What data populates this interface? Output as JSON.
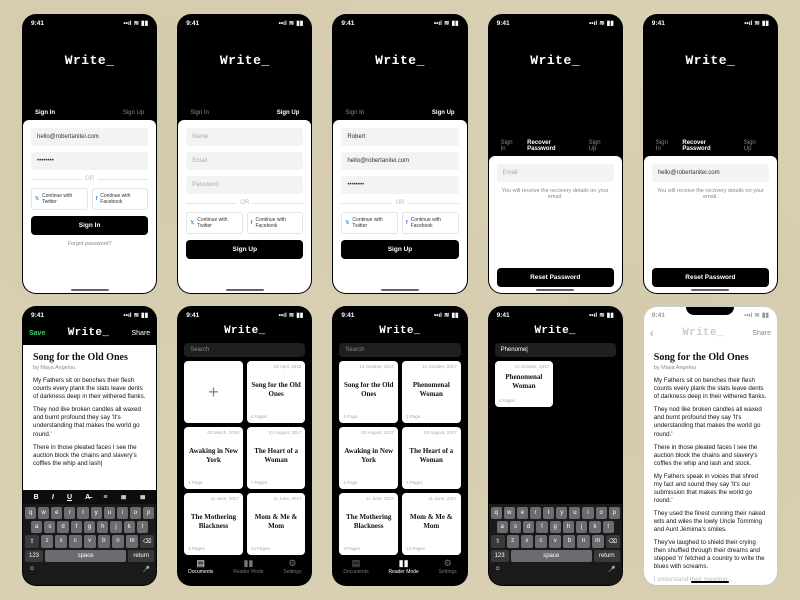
{
  "status": {
    "time": "9:41",
    "signal": "••ıl",
    "wifi": "≋",
    "battery": "▮▮"
  },
  "brand": "Write_",
  "tabs": {
    "signin": "Sign In",
    "signup": "Sign Up",
    "recover": "Recover Password"
  },
  "fields": {
    "email_val": "hello@robertanitei.com",
    "pw_val": "••••••••",
    "name_val": "Robert",
    "name_ph": "Name",
    "email_ph": "Email",
    "password_ph": "Password"
  },
  "or": "OR",
  "social": {
    "twitter": "Continue with Twitter",
    "facebook": "Continue with Facebook"
  },
  "buttons": {
    "signin": "Sign In",
    "signup": "Sign Up",
    "reset": "Reset Password"
  },
  "links": {
    "forgot": "Forgot password?"
  },
  "helper": {
    "recover": "You will receive the recovery details on your email."
  },
  "editor": {
    "save": "Save",
    "share": "Share",
    "back": "‹",
    "title": "Song for the Old Ones",
    "byline": "by Maya Angelou",
    "p1": "My Fathers sit on benches their flesh counts every plank the slats leave dents of darkness deep in their withered flanks.",
    "p2": "They nod like broken candles all waxed and burnt profound they say 'It's understanding that makes the world go round.'",
    "p3": "There in those pleated faces I see the auction block the chains and slavery's coffles the whip and lash|",
    "p3b": "There in those pleated faces I see the auction block the chains and slavery's coffles the whip and lash and stock.",
    "p4": "My Fathers speak in voices that shred my fact and sound they say 'It's our submission that makes the world go round.'",
    "p5": "They used the finest cunning their naked wits and wiles the lowly Uncle Tomming and Aunt Jemima's smiles.",
    "p6": "They've laughed to shield their crying then shuffled through their dreams and stepped 'n' fetched a country to write the blues with screams.",
    "p7": "I understand their meaning..."
  },
  "toolbar": {
    "bold": "B",
    "italic": "I",
    "underline": "U",
    "strike": "A̶",
    "alignl": "≡",
    "alignc": "≣",
    "alignr": "≣"
  },
  "keyboard": {
    "r1": [
      "q",
      "w",
      "e",
      "r",
      "t",
      "y",
      "u",
      "i",
      "o",
      "p"
    ],
    "r2": [
      "a",
      "s",
      "d",
      "f",
      "g",
      "h",
      "j",
      "k",
      "l"
    ],
    "r3": {
      "shift": "⇧",
      "keys": [
        "z",
        "x",
        "c",
        "v",
        "b",
        "n",
        "m"
      ],
      "del": "⌫"
    },
    "r4": {
      "num": "123",
      "emoji": "☺",
      "mic": "🎤",
      "space": "space",
      "ret": "return"
    }
  },
  "library": {
    "search_ph": "Search",
    "search_val": "Phenome|",
    "docs": [
      {
        "date": "02 April, 2018",
        "title": "Song for the Old Ones",
        "pages": "4 Pages"
      },
      {
        "date": "03 March, 2018",
        "title": "Awaking in New York",
        "pages": "1 Page"
      },
      {
        "date": "03 August, 2017",
        "title": "The Heart of a Woman",
        "pages": "7 Pages"
      },
      {
        "date": "11 June, 2017",
        "title": "The Mothering Blackness",
        "pages": "3 Pages"
      },
      {
        "date": "11 June, 2017",
        "title": "Mom & Me & Mom",
        "pages": "13 Pages"
      },
      {
        "date": "12 October, 2017",
        "title": "Phenomenal Woman",
        "pages": "1 Page"
      }
    ],
    "tabbar": {
      "docs": "Documents",
      "reader": "Reader Mode",
      "settings": "Settings",
      "docs_ico": "▤",
      "reader_ico": "▮▮",
      "settings_ico": "⚙"
    }
  }
}
